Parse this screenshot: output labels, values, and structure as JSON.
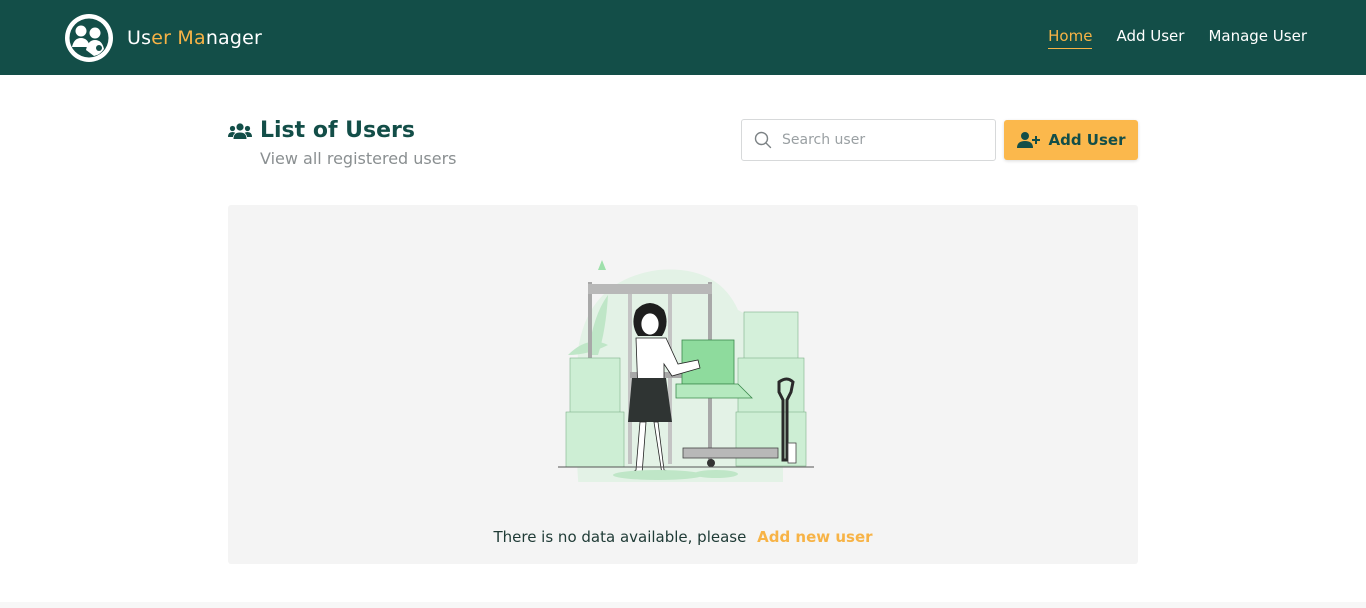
{
  "app": {
    "brand_part1": "Us",
    "brand_accent1": "er",
    "brand_part2": " ",
    "brand_accent2": "Ma",
    "brand_part3": "nager",
    "logo_icon": "user-manager-logo-icon"
  },
  "nav": {
    "items": [
      {
        "label": "Home",
        "active": true
      },
      {
        "label": "Add User",
        "active": false
      },
      {
        "label": "Manage User",
        "active": false
      }
    ]
  },
  "page": {
    "title": "List of Users",
    "subtitle": "View all registered users",
    "title_icon": "users-icon"
  },
  "search": {
    "placeholder": "Search user",
    "value": "",
    "icon": "search-icon"
  },
  "add_button": {
    "label": "Add User",
    "icon": "user-plus-icon"
  },
  "empty_state": {
    "message": "There is no data available, please",
    "link_label": "Add new user",
    "illustration": "warehouse-woman-boxes-illustration"
  },
  "colors": {
    "primary": "#134e48",
    "accent": "#f7b346",
    "button": "#fbb84c",
    "panel": "#f4f4f4",
    "illustration_green": "#9ee0ab"
  }
}
